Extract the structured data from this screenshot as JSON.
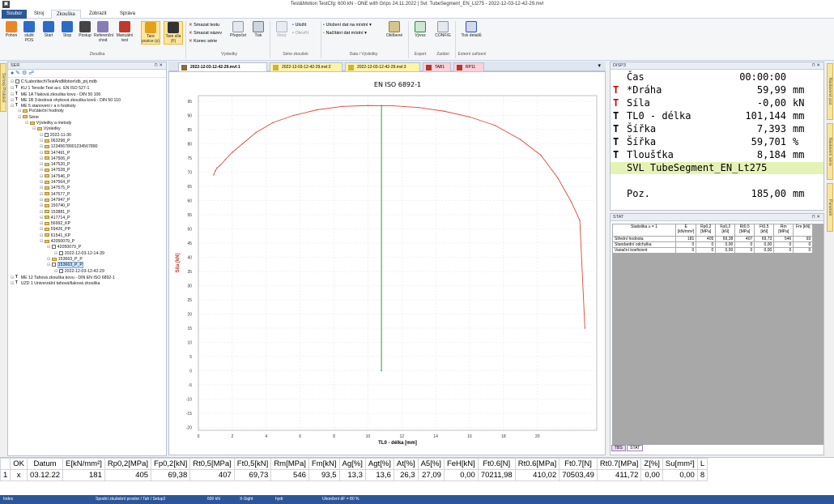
{
  "window": {
    "title": "Test&Motion   TestCfg: 600 kN - ONE with Grips 24.11.2022 | Svl: TubeSegment_EN_Lt275  -  2022-12-03-12-42-29.mvl"
  },
  "menu": [
    "Soubor",
    "Stroj",
    "Zkouška",
    "Zobrazit",
    "Správa"
  ],
  "ribbon": {
    "buttons": [
      {
        "label": "Pohon",
        "color": "#e8872a"
      },
      {
        "label": "služit POS",
        "color": "#2b6cc4"
      },
      {
        "label": "Start",
        "color": "#2b6cc4"
      },
      {
        "label": "Stop",
        "color": "#2b6cc4"
      },
      {
        "label": "Postup",
        "color": "#444444"
      },
      {
        "label": "Referenční chod",
        "color": "#8a7ab8"
      },
      {
        "label": "Manuální test",
        "color": "#c0392b"
      },
      {
        "label": "Tare pozice (s)",
        "color": "#e3a21a"
      },
      {
        "label": "Tare síla (F)",
        "color": "#333333"
      }
    ],
    "group_zkouska": "Zkouška",
    "vysledky_items": [
      "Smazat testu",
      "Smazat název",
      "Konec série"
    ],
    "prepocet": "Přepočet",
    "tisk": "Tisk",
    "group_vysledky": "Výsledky",
    "nova": "Nový",
    "ulozit": "Uložit",
    "otevrit": "Otevřít",
    "group_serie": "Série zkoušek",
    "data_items": [
      "Uložení dat na místní",
      "Načítání dat místní"
    ],
    "oblibene": "Oblíbené",
    "group_data": "Data / Výsledky",
    "vyvoz": "Vývoz",
    "config": "CONFIG",
    "group_export": "Export",
    "group_zadani": "Zadání",
    "tisk_detail": "Tisk detailů",
    "group_ext": "Externí zařízení"
  },
  "left_tabs": [
    "Sériový Protokol"
  ],
  "ser_panel": {
    "title": "SER",
    "tree": [
      {
        "indent": 0,
        "icon": "doc",
        "label": "C:\\Laboritech\\TestAndMotion\\db_prj.mdb"
      },
      {
        "indent": 0,
        "icon": "t",
        "label": "KU 1   Tensile Test acc. EN ISO 527-1"
      },
      {
        "indent": 0,
        "icon": "t",
        "label": "ME 1A  Tlaková zkouška kovu - DIN 50 106"
      },
      {
        "indent": 0,
        "icon": "t",
        "label": "ME 1B  3-bodová ohybová zkouška kovů - DIN 50 110"
      },
      {
        "indent": 0,
        "icon": "t",
        "label": "ME 5   stanovení r a n hodnoty"
      },
      {
        "indent": 1,
        "icon": "fi",
        "label": "Počáteční hodnoty"
      },
      {
        "indent": 1,
        "icon": "fi",
        "label": "Série"
      },
      {
        "indent": 2,
        "icon": "fi",
        "label": "Výsledky a metody"
      },
      {
        "indent": 3,
        "icon": "fi",
        "label": "Výsledky"
      },
      {
        "indent": 4,
        "icon": "doc",
        "label": "2022-11-30"
      },
      {
        "indent": 4,
        "icon": "fi",
        "label": "063298_P"
      },
      {
        "indent": 4,
        "icon": "fi",
        "label": "12345678901234567890"
      },
      {
        "indent": 4,
        "icon": "fi",
        "label": "147491_P"
      },
      {
        "indent": 4,
        "icon": "fi",
        "label": "147506_P"
      },
      {
        "indent": 4,
        "icon": "fi",
        "label": "147520_P"
      },
      {
        "indent": 4,
        "icon": "fi",
        "label": "147528_P"
      },
      {
        "indent": 4,
        "icon": "fi",
        "label": "147546_P"
      },
      {
        "indent": 4,
        "icon": "fi",
        "label": "147564_P"
      },
      {
        "indent": 4,
        "icon": "fi",
        "label": "147575_P"
      },
      {
        "indent": 4,
        "icon": "fi",
        "label": "147577_P"
      },
      {
        "indent": 4,
        "icon": "fi",
        "label": "147947_P"
      },
      {
        "indent": 4,
        "icon": "fi",
        "label": "150740_P"
      },
      {
        "indent": 4,
        "icon": "fi",
        "label": "153881_P"
      },
      {
        "indent": 4,
        "icon": "fi",
        "label": "417714_P"
      },
      {
        "indent": 4,
        "icon": "fi",
        "label": "56992_KP"
      },
      {
        "indent": 4,
        "icon": "fi",
        "label": "59426_PP"
      },
      {
        "indent": 4,
        "icon": "fi",
        "label": "61541_KP"
      },
      {
        "indent": 4,
        "icon": "fi",
        "label": "42050079_P"
      },
      {
        "indent": 5,
        "icon": "doc",
        "label": "42050079_P"
      },
      {
        "indent": 6,
        "icon": "doc",
        "label": "2022-12-03-12-14-39"
      },
      {
        "indent": 5,
        "icon": "fi",
        "label": "153663_P_P"
      },
      {
        "indent": 5,
        "icon": "doc",
        "label": "153663_P_P",
        "selected": true
      },
      {
        "indent": 6,
        "icon": "doc",
        "label": "2022-12-03-12-42-29"
      },
      {
        "indent": 0,
        "icon": "t",
        "label": "ME 12  Tahová zkouška kovu - DIN EN ISO 6892-1"
      },
      {
        "indent": 0,
        "icon": "t",
        "label": "UZD 1  Univerzální tahová/tlaková zkouška"
      }
    ]
  },
  "doc_tabs": [
    {
      "label": "2022-12-03-12-42-29.mvl:1",
      "color": "#8b6b3d",
      "active": true
    },
    {
      "label": "2022-12-03-12-42-29.mvl:2",
      "color": "#c9b53a"
    },
    {
      "label": "2022-12-03-12-42-29.mvl:3",
      "color": "#c9b53a"
    },
    {
      "label": "TAB1",
      "color": "#b0382c"
    },
    {
      "label": "RP11",
      "color": "#b0382c"
    }
  ],
  "chart_data": {
    "type": "line",
    "title": "EN ISO 6892-1",
    "xlabel": "TL0 - délka [mm]",
    "ylabel": "Síla [kN]",
    "xlim": [
      0,
      23.5
    ],
    "ylim": [
      -21,
      97
    ],
    "xticks": [
      0,
      2,
      4,
      6,
      8,
      10,
      12,
      14,
      16,
      18,
      20
    ],
    "yticks": [
      -20,
      -15,
      -10,
      -5,
      0,
      5,
      10,
      15,
      20,
      25,
      30,
      35,
      40,
      45,
      50,
      55,
      60,
      65,
      70,
      75,
      80,
      85,
      90,
      95
    ],
    "series": [
      {
        "name": "",
        "color": "#e0473a",
        "x": [
          0.9,
          1.0,
          1.1,
          1.3,
          1.6,
          2.0,
          2.6,
          3.4,
          4.4,
          5.6,
          7.0,
          8.5,
          10.0,
          11.5,
          13.0,
          14.5,
          16.0,
          17.5,
          19.0,
          20.2,
          21.2,
          22.0,
          22.5,
          22.8
        ],
        "y": [
          69.0,
          70.5,
          71.5,
          72.5,
          74.5,
          77.0,
          80.0,
          84.0,
          87.5,
          90.0,
          92.0,
          93.2,
          93.5,
          93.4,
          92.8,
          91.5,
          89.5,
          86.5,
          81.5,
          76.0,
          68.0,
          59.5,
          53.0,
          15.0
        ]
      },
      {
        "name": "",
        "color": "#2e9e3a",
        "x": [
          10.8,
          10.8,
          10.8,
          10.8
        ],
        "y": [
          0,
          93.5,
          93.5,
          0
        ]
      }
    ]
  },
  "disp": {
    "title": "DISP3",
    "rows": [
      {
        "pre": "",
        "name": "Čas",
        "value": "00:00:00",
        "unit": ""
      },
      {
        "pre": "T",
        "red": true,
        "name": "*Dráha",
        "value": "59,99",
        "unit": "mm"
      },
      {
        "pre": "T",
        "red": true,
        "name": "Síla",
        "value": "-0,00",
        "unit": "kN"
      },
      {
        "pre": "T",
        "name": "TL0 - délka",
        "value": "101,144",
        "unit": "mm"
      },
      {
        "pre": "T",
        "name": "Šířka",
        "value": "7,393",
        "unit": "mm"
      },
      {
        "pre": "T",
        "name": "Šířka",
        "value": "59,701",
        "unit": "%"
      },
      {
        "pre": "T",
        "name": "Tloušťka",
        "value": "8,184",
        "unit": "mm"
      }
    ],
    "svl": "SVL TubeSegment_EN_Lt275",
    "poz_label": "Poz.",
    "poz_value": "185,00",
    "poz_unit": "mm"
  },
  "stat": {
    "title": "STAT",
    "header_label": "Statistika ≥ = 1",
    "columns": [
      "E [kN/mm²]",
      "Rp0,2 [MPa]",
      "Fp0,2 [kN]",
      "Rt0,5 [MPa]",
      "Ft0,5 [kN]",
      "Rm [MPa]",
      "Fm [kN]"
    ],
    "rows": [
      {
        "label": "Střední hodnota",
        "values": [
          "181",
          "405",
          "69,38",
          "407",
          "69,73",
          "546",
          "93"
        ]
      },
      {
        "label": "Standardní odchylka",
        "values": [
          "0",
          "0",
          "0,00",
          "0",
          "0,00",
          "0",
          "0"
        ]
      },
      {
        "label": "Variační koeficient",
        "values": [
          "0",
          "0",
          "0,00",
          "0",
          "0,00",
          "0",
          "0"
        ]
      }
    ],
    "bottom_tabs": [
      "TBS",
      "STAT"
    ]
  },
  "right_tabs": [
    "Nastavené poz.",
    "Nastavení série",
    "Parametr"
  ],
  "results": {
    "headers": [
      "",
      "OK",
      "Datum",
      "E[kN/mm²]",
      "Rp0,2[MPa]",
      "Fp0,2[kN]",
      "Rt0,5[MPa]",
      "Ft0,5[kN]",
      "Rm[MPa]",
      "Fm[kN]",
      "Ag[%]",
      "Agt[%]",
      "At[%]",
      "A5[%]",
      "FeH[kN]",
      "Ft0.6[N]",
      "Rt0.6[MPa]",
      "Ft0.7[N]",
      "Rt0.7[MPa]",
      "Z[%]",
      "Su[mm²]",
      "L"
    ],
    "row": [
      "1",
      "x",
      "03.12.22",
      "181",
      "405",
      "69,38",
      "407",
      "69,73",
      "546",
      "93,5",
      "13,3",
      "13,6",
      "26,3",
      "27,09",
      "0,00",
      "70211,98",
      "410,02",
      "70503,49",
      "411,72",
      "0,00",
      "0,00",
      "8"
    ]
  },
  "status": {
    "left": "Index",
    "items": [
      "Spodní zkušební prostor / Tah / Setup2",
      "600 kN",
      "X-Sight",
      "hydr",
      "Ukončení dF = 80 %"
    ]
  }
}
